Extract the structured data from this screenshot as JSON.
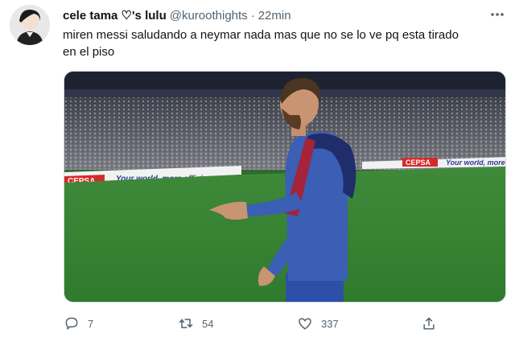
{
  "tweet": {
    "display_name": "cele tama ♡'s lulu",
    "handle": "@kuroothights",
    "separator": "·",
    "time": "22min",
    "text": "miren messi saludando a neymar nada mas que no se lo ve pq esta tirado\nen el piso",
    "image": {
      "ad_board_left_brand": "CEPSA",
      "ad_board_left_slogan": "Your world, more efficient",
      "ad_board_right_brand": "CEPSA",
      "ad_board_right_slogan": "Your world, more"
    },
    "actions": {
      "reply_count": "7",
      "retweet_count": "54",
      "like_count": "337"
    }
  },
  "colors": {
    "text_primary": "#0f1419",
    "text_secondary": "#536471",
    "pitch_green": "#3f8a3a",
    "jersey_blue": "#3a5fb5"
  },
  "icons": [
    "more-icon",
    "reply-icon",
    "retweet-icon",
    "like-icon",
    "share-icon"
  ]
}
